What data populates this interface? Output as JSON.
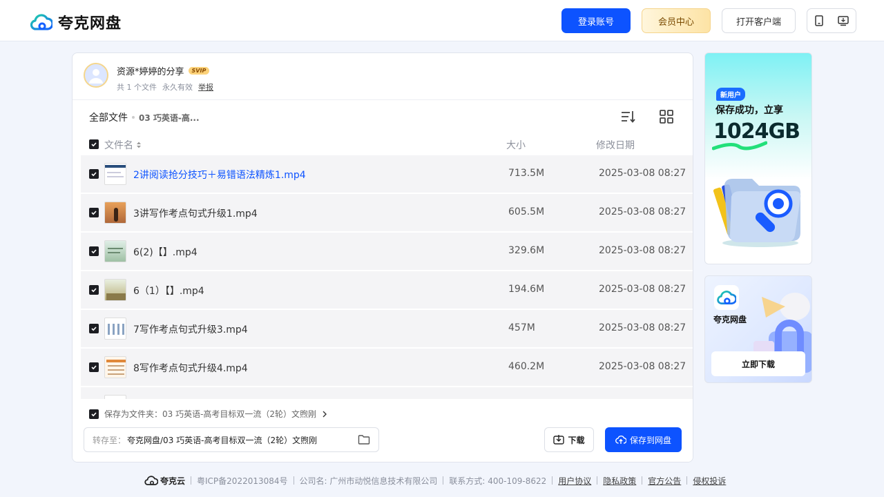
{
  "header": {
    "logo_text": "夸克网盘",
    "login_label": "登录账号",
    "vip_label": "会员中心",
    "client_label": "打开客户端"
  },
  "share": {
    "title": "资源*婷婷的分享",
    "badge": "SVIP",
    "count": "共 1 个文件",
    "validity": "永久有效",
    "report": "举报"
  },
  "breadcrumb": {
    "root": "全部文件",
    "current": "03 巧英语-高..."
  },
  "columns": {
    "name": "文件名",
    "size": "大小",
    "date": "修改日期"
  },
  "files": [
    {
      "name": "2讲阅读抢分技巧＋易错语法精炼1.mp4",
      "size": "713.5M",
      "date": "2025-03-08 08:27"
    },
    {
      "name": "3讲写作考点句式升级1.mp4",
      "size": "605.5M",
      "date": "2025-03-08 08:27"
    },
    {
      "name": "6(2)【】.mp4",
      "size": "329.6M",
      "date": "2025-03-08 08:27"
    },
    {
      "name": "6（1）【】.mp4",
      "size": "194.6M",
      "date": "2025-03-08 08:27"
    },
    {
      "name": "7写作考点句式升级3.mp4",
      "size": "457M",
      "date": "2025-03-08 08:27"
    },
    {
      "name": "8写作考点句式升级4.mp4",
      "size": "460.2M",
      "date": "2025-03-08 08:27"
    }
  ],
  "save": {
    "folder_label": "保存为文件夹：03 巧英语-高考目标双一流（2轮）文煦刚",
    "path_label": "转存至：",
    "path_value": "夸克网盘/03 巧英语-高考目标双一流（2轮）文煦刚",
    "download_label": "下载",
    "save_label": "保存到网盘"
  },
  "ads": {
    "tag": "新用户",
    "line1": "保存成功，立享",
    "big": "1024GB",
    "app_name": "夸克网盘",
    "download_now": "立即下载"
  },
  "footer": {
    "brand": "夸克云",
    "icp": "粤ICP备2022013084号",
    "company": "公司名: 广州市动悦信息技术有限公司",
    "contact": "联系方式: 400-109-8622",
    "links": [
      "用户协议",
      "隐私政策",
      "官方公告",
      "侵权投诉"
    ]
  },
  "colors": {
    "primary": "#0d53ff",
    "checkbox": "#1c1d22",
    "row_bg": "#f4f4f6"
  }
}
